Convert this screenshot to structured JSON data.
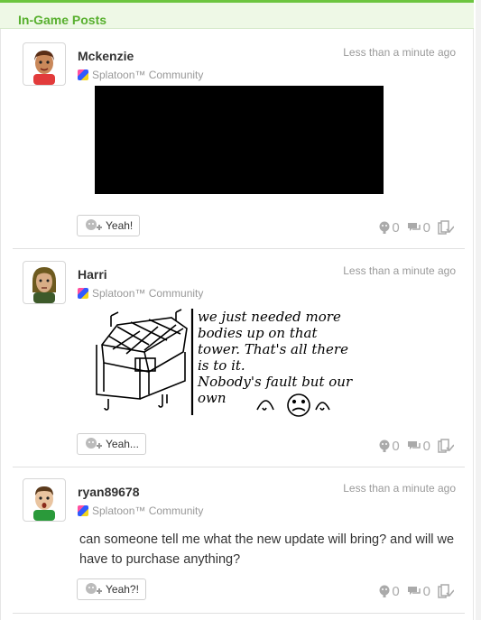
{
  "section": {
    "title": "In-Game Posts"
  },
  "posts": [
    {
      "author": "Mckenzie",
      "timestamp": "Less than a minute ago",
      "community": "Splatoon™ Community",
      "content_type": "screenshot",
      "yeah_label": "Yeah!",
      "yeah_count": "0",
      "comment_count": "0",
      "skin": "#c9885a",
      "hair": "#5a2e17",
      "shirt": "#e23b3b"
    },
    {
      "author": "Harri",
      "timestamp": "Less than a minute ago",
      "community": "Splatoon™ Community",
      "content_type": "drawing",
      "drawing_text": [
        "we just needed more",
        "bodies up on that",
        "tower. That's all there",
        "is to it.",
        "Nobody's fault but our",
        "own"
      ],
      "yeah_label": "Yeah...",
      "yeah_count": "0",
      "comment_count": "0",
      "skin": "#d8ad86",
      "hair": "#6d5a1f",
      "shirt": "#3d5a2a"
    },
    {
      "author": "ryan89678",
      "timestamp": "Less than a minute ago",
      "community": "Splatoon™ Community",
      "content_type": "text",
      "text": "can someone tell me what the new update will bring? and will we have to purchase anything?",
      "yeah_label": "Yeah?!",
      "yeah_count": "0",
      "comment_count": "0",
      "skin": "#e9c4a0",
      "hair": "#5b3a1c",
      "shirt": "#2a9a3a"
    }
  ]
}
